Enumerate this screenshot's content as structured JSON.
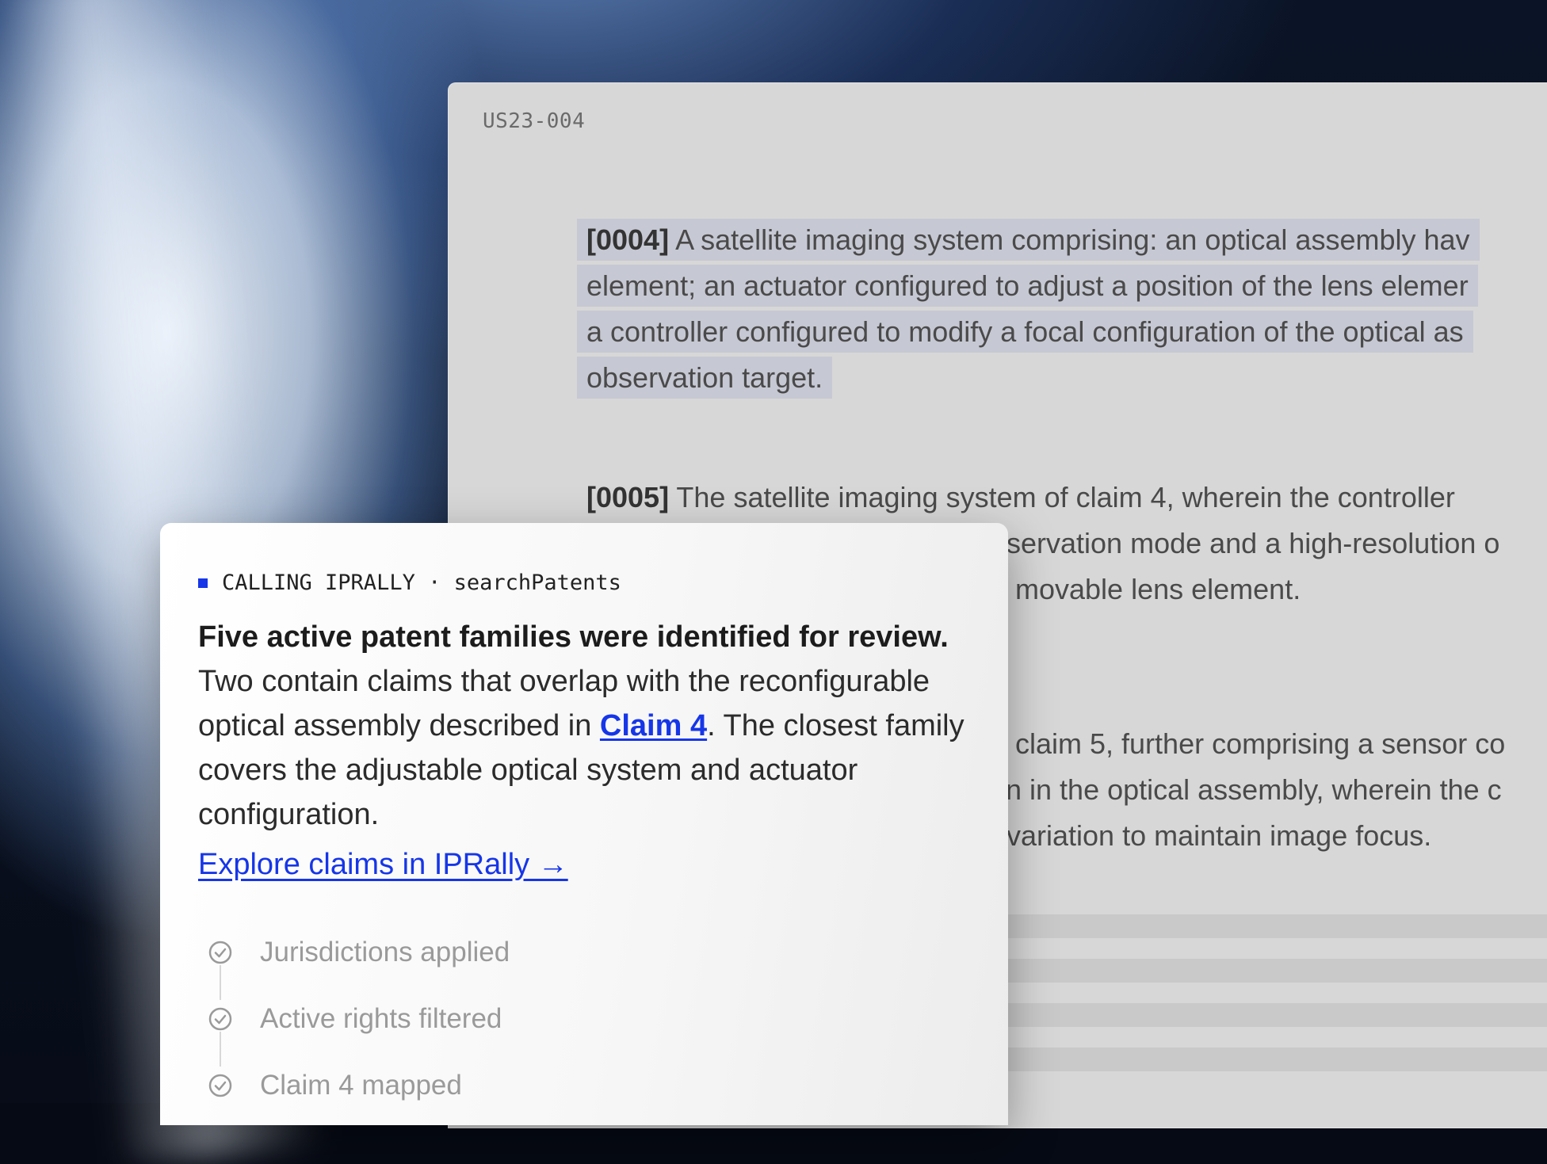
{
  "document": {
    "id": "US23-004",
    "paragraphs": [
      {
        "num": "[0004]",
        "lines": [
          "A satellite imaging system comprising: an optical assembly hav",
          "element; an actuator configured to adjust a position of the lens elemer",
          "a controller configured to modify a focal configuration of the optical as",
          "observation target."
        ]
      },
      {
        "num": "[0005]",
        "lines": [
          "The satellite imaging system of claim 4, wherein the controller",
          "servation mode and a high-resolution o",
          "movable lens element."
        ]
      },
      {
        "lines": [
          "f claim 5, further comprising a sensor co",
          "n in the optical assembly, wherein the c",
          "variation to maintain image focus."
        ]
      }
    ]
  },
  "card": {
    "calling_label": "CALLING IPRALLY · searchPatents",
    "lead": "Five active patent families were identified for review.",
    "body_before_link": "Two contain claims that overlap with the reconfigurable optical assembly described in",
    "claim_link": "Claim 4",
    "body_after_link": ". The closest family covers the adjustable optical system and actuator configuration.",
    "explore_link": "Explore claims in IPRally →",
    "steps": [
      {
        "label": "Jurisdictions applied",
        "icon": "check-circle-icon"
      },
      {
        "label": "Active rights filtered",
        "icon": "check-circle-icon"
      },
      {
        "label": "Claim 4 mapped",
        "icon": "check-circle-icon"
      }
    ]
  },
  "colors": {
    "accent": "#1636e8",
    "highlight": "#c6c8d3",
    "document_bg": "#d7d7d7"
  }
}
